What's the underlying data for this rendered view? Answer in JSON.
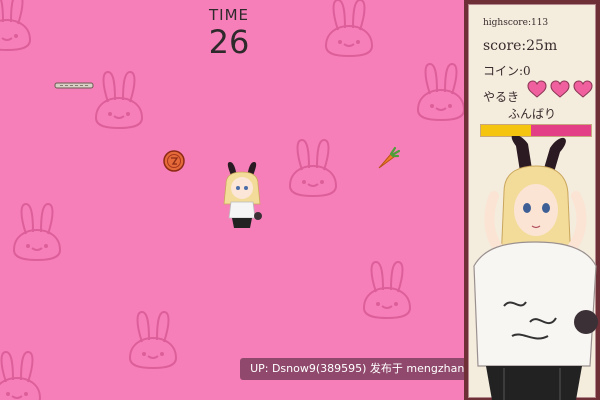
{
  "hud": {
    "time_label": "TIME",
    "time_value": "26"
  },
  "panel": {
    "highscore": "highscore:113",
    "score": "score:25m",
    "coins": "コイン:0",
    "yaruki_label": "やるき",
    "hearts_filled": 3,
    "hearts_total": 3,
    "funbari_label": "ふんばり",
    "funbari_level": 0.45
  },
  "watermark": "UP: Dsnow9(389595) 发布于 mengzhan.cc",
  "colors": {
    "field_bg": "#f77fb9",
    "bunny_line": "#dd5f9a",
    "panel_frame": "#6e2f37",
    "panel_bg": "#f4ecdd",
    "heart": "#f0609f",
    "bar_fill": "#f4c40f",
    "bar_empty": "#e23f86"
  },
  "icons": {
    "coin": "coin-icon",
    "carrot": "carrot-icon",
    "log": "log-obstacle-icon",
    "heart": "heart-icon",
    "bunny": "bunny-face-icon"
  }
}
